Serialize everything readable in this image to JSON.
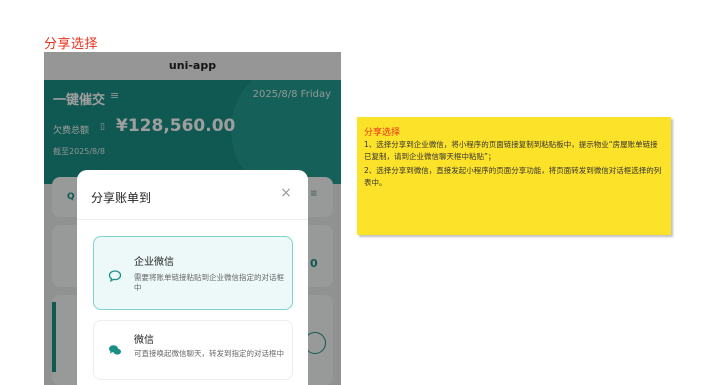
{
  "page": {
    "heading": "分享选择"
  },
  "phone": {
    "app_title": "uni-app",
    "banner": {
      "title": "一键催交",
      "menu_icon": "≡",
      "date": "2025/8/8 Friday",
      "owed_label": "欠费总额",
      "owed_amount": "¥128,560.00",
      "as_of": "截至2025/8/8"
    },
    "background_icons": {
      "search": "Q",
      "list": "≡",
      "digit": "0"
    }
  },
  "share_dialog": {
    "title": "分享账单到",
    "close_icon": "×",
    "options": [
      {
        "name": "企业微信",
        "desc": "需要将账单链接粘贴到企业微信指定的对话框中",
        "icon": "chat-bubble-icon"
      },
      {
        "name": "微信",
        "desc": "可直接唤起微信聊天，转发到指定的对话框中",
        "icon": "wechat-icon"
      }
    ]
  },
  "note": {
    "title": "分享选择",
    "lines": [
      "1、选择分享到企业微信，将小程序的页面链接复制到粘贴板中，提示物业“房屋账单链接已复制，请到企业微信聊天框中粘贴”；",
      "2、选择分享到微信，直接发起小程序的页面分享功能，将页面转发到微信对话框选择的列表中。"
    ]
  },
  "colors": {
    "accent": "#1a8f85",
    "heading_red": "#e8321e",
    "note_yellow": "#fde22a"
  }
}
